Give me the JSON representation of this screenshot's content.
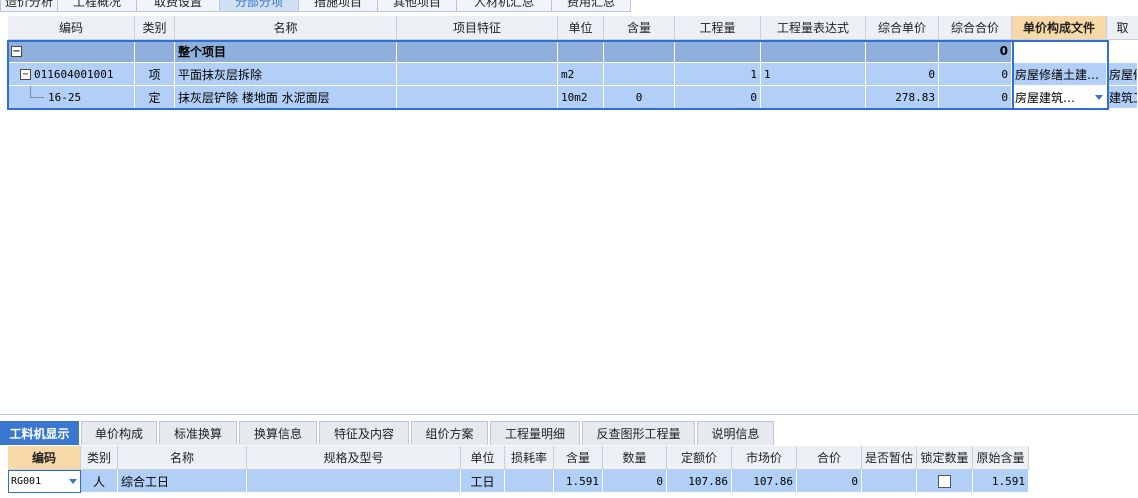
{
  "top_tabs": [
    "造价分析",
    "工程概况",
    "取费设置",
    "分部分项",
    "措施项目",
    "其他项目",
    "人材机汇总",
    "费用汇总"
  ],
  "top_tab_active": 3,
  "main_grid": {
    "headers": [
      "编码",
      "类别",
      "名称",
      "项目特征",
      "单位",
      "含量",
      "工程量",
      "工程量表达式",
      "综合单价",
      "综合合价",
      "单价构成文件",
      "取"
    ],
    "total_row": {
      "name": "整个项目",
      "total": "0"
    },
    "rows": [
      {
        "code": "011604001001",
        "type": "项",
        "name": "平面抹灰层拆除",
        "feature": "",
        "unit": "m2",
        "content": "",
        "quantity": "1",
        "expression": "1",
        "unit_price": "0",
        "total_price": "0",
        "price_file": "房屋修缮土建…",
        "extra": "房屋修"
      },
      {
        "code": "16-25",
        "type": "定",
        "name": "抹灰层铲除 楼地面 水泥面层",
        "feature": "",
        "unit": "10m2",
        "content": "0",
        "quantity": "0",
        "expression": "",
        "unit_price": "278.83",
        "total_price": "0",
        "price_file": "房屋建筑…",
        "extra": "建筑工"
      }
    ]
  },
  "bottom_tabs": [
    "工料机显示",
    "单价构成",
    "标准换算",
    "换算信息",
    "特征及内容",
    "组价方案",
    "工程量明细",
    "反查图形工程量",
    "说明信息"
  ],
  "bottom_tab_active": 0,
  "bottom_grid": {
    "headers": [
      "编码",
      "类别",
      "名称",
      "规格及型号",
      "单位",
      "损耗率",
      "含量",
      "数量",
      "定额价",
      "市场价",
      "合价",
      "是否暂估",
      "锁定数量",
      "原始含量"
    ],
    "rows": [
      {
        "code": "RG001",
        "type": "人",
        "name": "综合工日",
        "spec": "",
        "unit": "工日",
        "loss": "",
        "content": "1.591",
        "amount": "0",
        "quota_price": "107.86",
        "market_price": "107.86",
        "total": "0",
        "estimated": "",
        "original_content": "1.591"
      }
    ]
  },
  "colors": {
    "selection_border": "#2f6fd3",
    "row_selected": "#b2d0f7",
    "total_row": "#8fb0dc",
    "header_highlight": "#f7d9a7",
    "active_tab": "#3a78d0"
  }
}
